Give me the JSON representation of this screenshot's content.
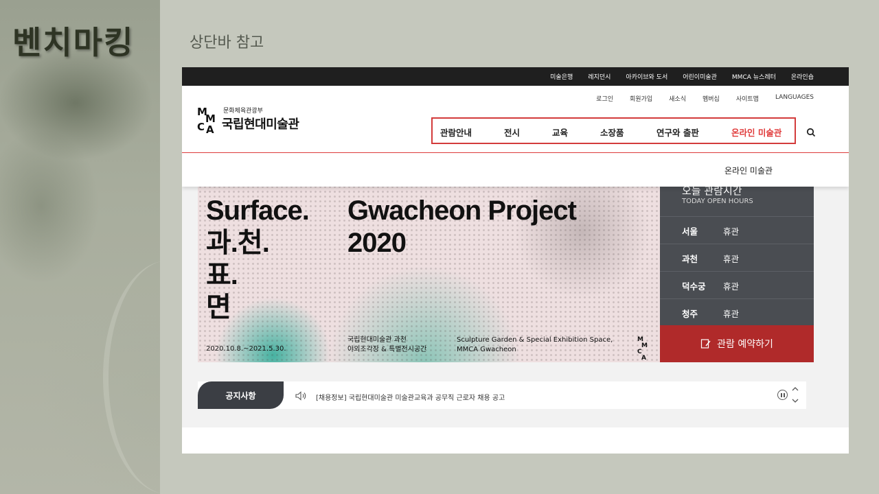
{
  "slide": {
    "title": "벤치마킹",
    "subtitle": "상단바 참고"
  },
  "topbar": {
    "links": [
      "미술은행",
      "레지던시",
      "아카이브와 도서",
      "어린이미술관",
      "MMCA 뉴스레터",
      "온라인숍"
    ]
  },
  "utility": {
    "links": [
      "로그인",
      "회원가입",
      "새소식",
      "멤버십",
      "사이트맵",
      "LANGUAGES"
    ]
  },
  "logo": {
    "ministry": "문화체육관광부",
    "name": "국립현대미술관",
    "mark": [
      "M",
      "M",
      "C",
      "A"
    ]
  },
  "gnb": {
    "items": [
      "관람안내",
      "전시",
      "교육",
      "소장품",
      "연구와 출판",
      "온라인 미술관"
    ],
    "active_index": 5,
    "active_color": "#e03b3b"
  },
  "submenu": {
    "item": "온라인 미술관"
  },
  "banner": {
    "left_lines": [
      "Surface.",
      "과.천.",
      "표.",
      "면"
    ],
    "right_lines": [
      "Gwacheon Project",
      "2020"
    ],
    "date": "2020.10.8.~2021.5.30.",
    "venue_kor": [
      "국립현대미술관 과천",
      "야외조각장 & 특별전시공간"
    ],
    "venue_eng": [
      "Sculpture Garden & Special Exhibition Space,",
      "MMCA Gwacheon"
    ],
    "mark": [
      "M",
      "M",
      "C",
      "A"
    ]
  },
  "hours": {
    "title": "오늘 관람시간",
    "subtitle": "TODAY OPEN HOURS",
    "rows": [
      {
        "location": "서울",
        "status": "휴관"
      },
      {
        "location": "과천",
        "status": "휴관"
      },
      {
        "location": "덕수궁",
        "status": "휴관"
      },
      {
        "location": "청주",
        "status": "휴관"
      }
    ],
    "reserve_label": "관람 예약하기",
    "panel_color": "#4a4d52",
    "reserve_color": "#b02a2a"
  },
  "notice": {
    "tab_label": "공지사항",
    "text": "[채용정보] 국립현대미술관 미술관교육과 공무직 근로자 채용 공고"
  }
}
